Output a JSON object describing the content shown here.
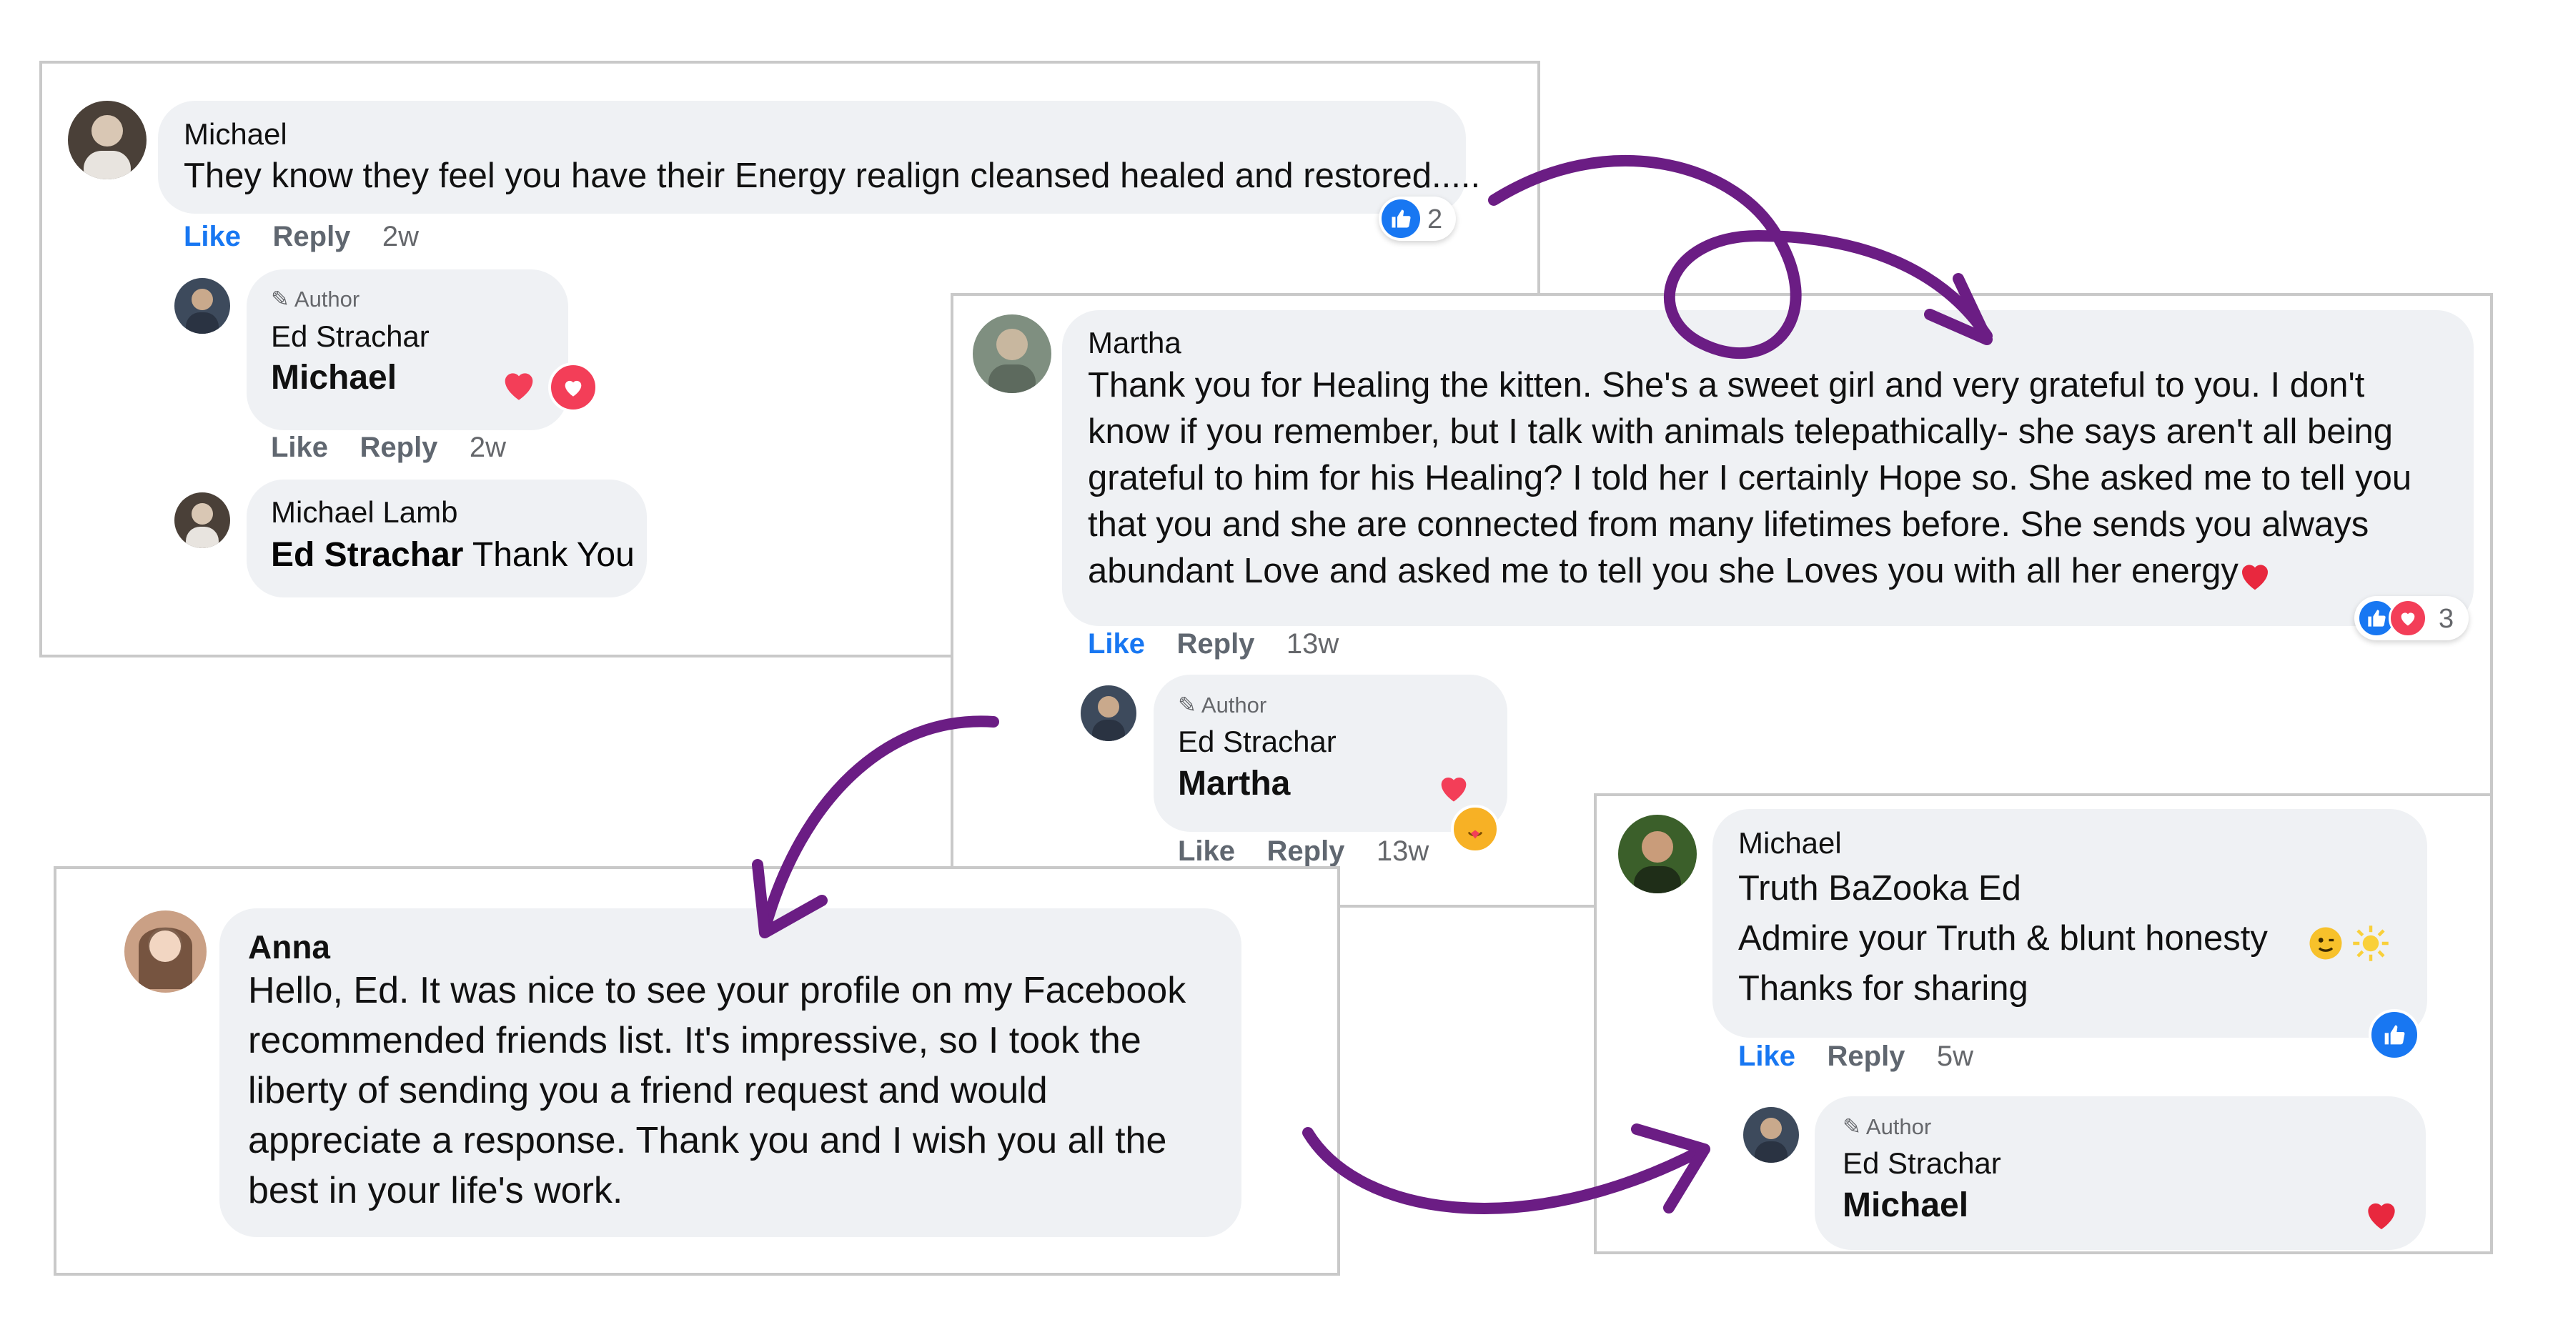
{
  "colors": {
    "like_blue": "#1877f2",
    "heart_red": "#f33e58",
    "arrow_purple": "#6b1d84",
    "bubble_bg": "#eff1f4",
    "border": "#c9c9c9"
  },
  "actions": {
    "like": "Like",
    "reply": "Reply"
  },
  "author_label": "Author",
  "panel1": {
    "c1": {
      "name": "Michael",
      "text": "They know they feel you have their Energy realign cleansed healed and restored.....",
      "time": "2w",
      "reaction_count": "2"
    },
    "c2": {
      "author_name": "Ed Strachar",
      "mention": "Michael",
      "time": "2w"
    },
    "c3": {
      "name": "Michael Lamb",
      "mention": "Ed Strachar",
      "text": " Thank You"
    }
  },
  "panel2": {
    "c1": {
      "name": "Martha",
      "lines": [
        "Thank you for Healing the kitten. She's a sweet girl and very grateful to you. I don't",
        "know if you remember, but I talk with animals telepathically- she says aren't all being",
        "grateful to him for his Healing? I told her I certainly Hope so. She asked me to tell you",
        "that you and she are connected from many lifetimes before. She sends you always",
        "abundant Love and asked me to tell you she Loves you with all her energy"
      ],
      "time": "13w",
      "reaction_count": "3"
    },
    "c2": {
      "author_name": "Ed Strachar",
      "mention": "Martha",
      "time": "13w"
    }
  },
  "panel3": {
    "c1": {
      "name": "Anna",
      "lines": [
        "Hello, Ed. It was nice to see your profile on my Facebook",
        "recommended friends list. It's impressive, so I took the",
        "liberty of sending you a friend request and would",
        "appreciate a response. Thank you and I wish you all the",
        "best in your life's work."
      ]
    }
  },
  "panel4": {
    "c1": {
      "name": "Michael",
      "lines": [
        "Truth BaZooka Ed",
        "Admire your Truth & blunt honesty",
        "Thanks for sharing"
      ],
      "time": "5w"
    },
    "c2": {
      "author_name": "Ed Strachar",
      "mention": "Michael"
    }
  }
}
